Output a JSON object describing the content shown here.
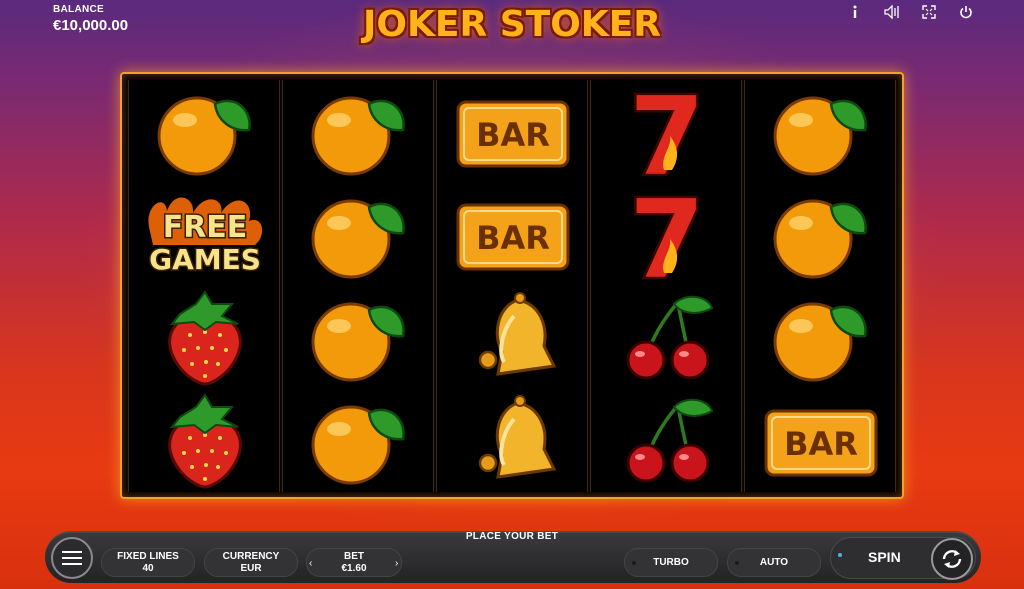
{
  "header": {
    "balance_label": "BALANCE",
    "balance_value": "€10,000.00",
    "game_title": "JOKER STOKER",
    "icons": [
      "info-icon",
      "sound-icon",
      "fullscreen-icon",
      "power-icon"
    ]
  },
  "reels": [
    [
      "orange",
      "free-games",
      "strawberry",
      "strawberry"
    ],
    [
      "orange",
      "orange",
      "orange",
      "orange"
    ],
    [
      "bar",
      "bar",
      "bell",
      "bell"
    ],
    [
      "seven",
      "seven",
      "cherry",
      "cherry"
    ],
    [
      "orange",
      "orange",
      "orange",
      "bar"
    ]
  ],
  "symbols": {
    "bar_text": "BAR",
    "seven_text": "7",
    "free_games_line1": "FREE",
    "free_games_line2": "GAMES"
  },
  "controls": {
    "place_bet_label": "PLACE YOUR BET",
    "fixed_lines_label": "FIXED LINES",
    "fixed_lines_value": "40",
    "currency_label": "CURRENCY",
    "currency_value": "EUR",
    "bet_label": "BET",
    "bet_value": "€1.60",
    "bet_decrease": "‹",
    "bet_increase": "›",
    "turbo_label": "TURBO",
    "auto_label": "AUTO",
    "spin_label": "SPIN"
  },
  "colors": {
    "frame_border": "#f2a12a",
    "title": "#ffb21a",
    "bar_symbol": "#f4a21a"
  }
}
